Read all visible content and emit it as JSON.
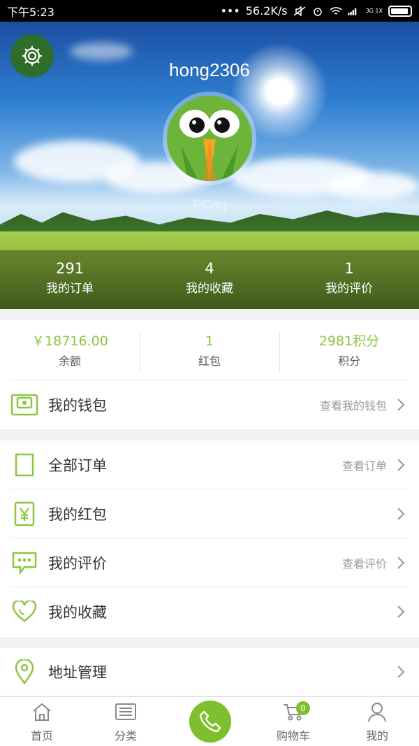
{
  "status_bar": {
    "time": "下午5:23",
    "network_speed": "56.2K/s",
    "signal_tag": "3G 1X"
  },
  "profile": {
    "username": "hong2306",
    "nickname": "PCqq",
    "stats": [
      {
        "value": "291",
        "label": "我的订单"
      },
      {
        "value": "4",
        "label": "我的收藏"
      },
      {
        "value": "1",
        "label": "我的评价"
      }
    ]
  },
  "balance": {
    "items": [
      {
        "value": "￥18716.00",
        "label": "余额"
      },
      {
        "value": "1",
        "label": "红包"
      },
      {
        "value": "2981积分",
        "label": "积分"
      }
    ],
    "wallet": {
      "label": "我的钱包",
      "hint": "查看我的钱包"
    }
  },
  "menu": [
    {
      "label": "全部订单",
      "hint": "查看订单",
      "icon": "document-icon"
    },
    {
      "label": "我的红包",
      "hint": "",
      "icon": "yuan-icon"
    },
    {
      "label": "我的评价",
      "hint": "查看评价",
      "icon": "comment-icon"
    },
    {
      "label": "我的收藏",
      "hint": "",
      "icon": "heart-icon"
    }
  ],
  "address": {
    "label": "地址管理",
    "icon": "location-pin-icon"
  },
  "tabbar": {
    "tabs": [
      {
        "label": "首页",
        "icon": "home-icon"
      },
      {
        "label": "分类",
        "icon": "list-icon"
      },
      {
        "label": "",
        "icon": "phone-icon"
      },
      {
        "label": "购物车",
        "icon": "cart-icon"
      },
      {
        "label": "我的",
        "icon": "person-icon"
      }
    ],
    "cart_badge": "0"
  },
  "colors": {
    "accent": "#8cc63f",
    "tab_accent": "#7dbf2c",
    "settings_bg": "#2f6d2a"
  }
}
